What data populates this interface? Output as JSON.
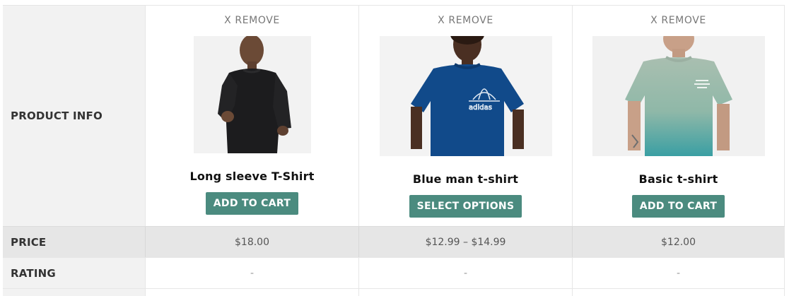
{
  "labels": {
    "product_info": "PRODUCT INFO",
    "price": "PRICE",
    "rating": "RATING"
  },
  "products": [
    {
      "remove_label": "X REMOVE",
      "name": "Long sleeve T-Shirt",
      "button_label": "ADD TO CART",
      "price": "$18.00",
      "rating": "-",
      "image": {
        "subject": "man in black long sleeve t-shirt",
        "shirt_color": "#1c1c1e",
        "background": "#f2f2f2"
      }
    },
    {
      "remove_label": "X REMOVE",
      "name": "Blue man t-shirt",
      "button_label": "SELECT OPTIONS",
      "price": "$12.99 – $14.99",
      "rating": "-",
      "image": {
        "subject": "man in blue adidas t-shirt",
        "shirt_color": "#114a8a",
        "background": "#f3f3f3"
      }
    },
    {
      "remove_label": "X REMOVE",
      "name": "Basic t-shirt",
      "button_label": "ADD TO CART",
      "price": "$12.00",
      "rating": "-",
      "image": {
        "subject": "man in sage-to-teal gradient t-shirt",
        "shirt_color": "#8fb3a2",
        "background": "#f1f1f1"
      }
    }
  ],
  "colors": {
    "accent": "#4b8b7f",
    "label_bg": "#f2f2f2",
    "price_row_bg": "#e6e6e6",
    "border": "#e6e6e6"
  }
}
